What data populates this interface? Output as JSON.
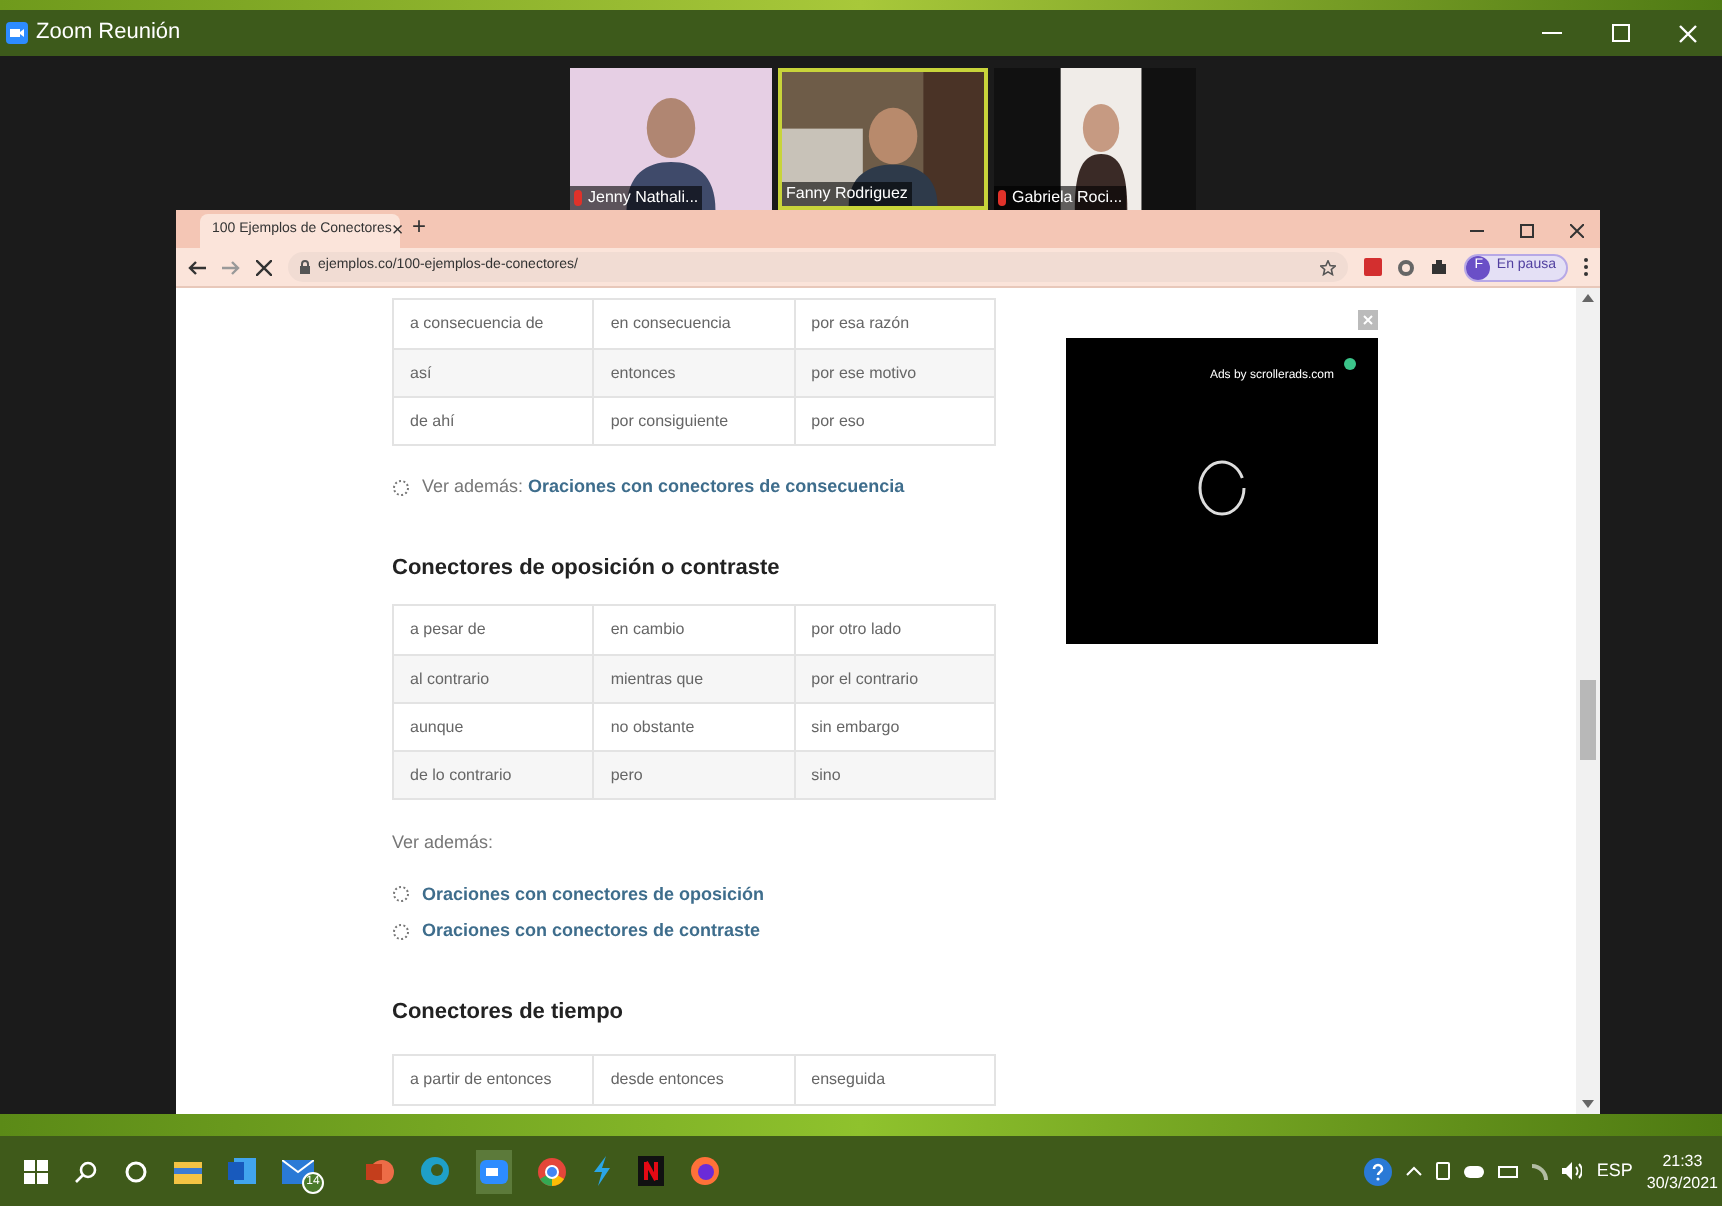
{
  "zoom_window": {
    "title": "Zoom Reunión"
  },
  "participants": [
    {
      "name": "Jenny Nathali...",
      "muted": true,
      "selected": false
    },
    {
      "name": "Fanny Rodriguez",
      "muted": false,
      "selected": true
    },
    {
      "name": "Gabriela Roci...",
      "muted": true,
      "selected": false
    }
  ],
  "browser": {
    "tab": {
      "title": "100 Ejemplos de Conectores",
      "close": "×",
      "new": "+"
    },
    "url": "ejemplos.co/100-ejemplos-de-conectores/",
    "profile": {
      "initial": "F",
      "label": "En pausa"
    }
  },
  "page": {
    "blocks": [
      {
        "kind": "table",
        "rows": [
          [
            "a consecuencia de",
            "en consecuencia",
            "por esa razón"
          ],
          [
            "así",
            "entonces",
            "por ese motivo"
          ],
          [
            "de ahí",
            "por consiguiente",
            "por eso"
          ]
        ]
      },
      {
        "kind": "see_also",
        "label": "Ver además:",
        "link": "Oraciones con conectores de consecuencia"
      },
      {
        "kind": "heading",
        "text": "Conectores de oposición o contraste"
      },
      {
        "kind": "table",
        "rows": [
          [
            "a pesar de",
            "en cambio",
            "por otro lado"
          ],
          [
            "al contrario",
            "mientras que",
            "por el contrario"
          ],
          [
            "aunque",
            "no obstante",
            "sin embargo"
          ],
          [
            "de lo contrario",
            "pero",
            "sino"
          ]
        ]
      },
      {
        "kind": "label",
        "text": "Ver además:"
      },
      {
        "kind": "links",
        "items": [
          "Oraciones con conectores de oposición",
          "Oraciones con conectores de contraste"
        ]
      },
      {
        "kind": "heading",
        "text": "Conectores de tiempo"
      },
      {
        "kind": "table",
        "rows": [
          [
            "a partir de entonces",
            "desde entonces",
            "enseguida"
          ]
        ]
      }
    ],
    "ad": {
      "label": "Ads by scrollerads.com"
    }
  },
  "taskbar": {
    "mail_badge": "14",
    "language": "ESP",
    "time": "21:33",
    "date": "30/3/2021"
  }
}
